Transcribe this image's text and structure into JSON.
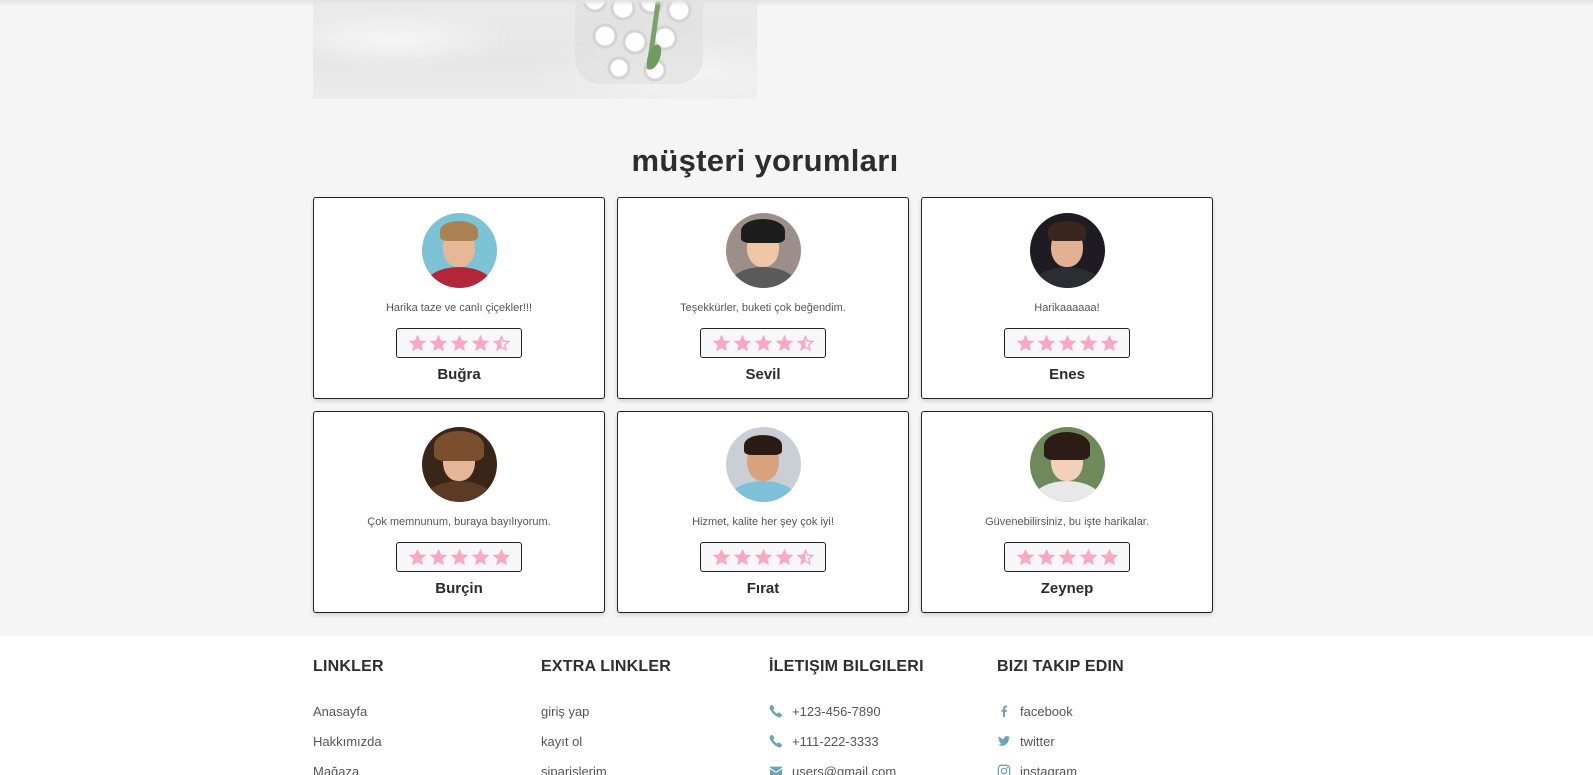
{
  "page": {
    "section_title": "müşteri yorumları"
  },
  "colors": {
    "star": "#f7a8c9",
    "icon": "#6aa7b3",
    "border": "#222222"
  },
  "reviews": [
    {
      "name": "Buğra",
      "text": "Harika taze ve canlı çiçekler!!!",
      "rating": 4.5
    },
    {
      "name": "Sevil",
      "text": "Teşekkürler, buketi çok beğendim.",
      "rating": 4.5
    },
    {
      "name": "Enes",
      "text": "Harikaaaaaa!",
      "rating": 5
    },
    {
      "name": "Burçin",
      "text": "Çok memnunum, buraya bayılıyorum.",
      "rating": 5
    },
    {
      "name": "Fırat",
      "text": "Hizmet, kalite her şey çok iyi!",
      "rating": 4.5
    },
    {
      "name": "Zeynep",
      "text": "Güvenebilirsiniz, bu işte harikalar.",
      "rating": 5
    }
  ],
  "footer": {
    "links": {
      "title": "LINKLER",
      "items": [
        "Anasayfa",
        "Hakkımızda",
        "Mağaza"
      ]
    },
    "extra": {
      "title": "EXTRA LINKLER",
      "items": [
        "giriş yap",
        "kayıt ol",
        "siparişlerim"
      ]
    },
    "contact": {
      "title": "İLETIŞIM BILGILERI",
      "items": [
        {
          "icon": "phone-icon",
          "text": "+123-456-7890"
        },
        {
          "icon": "phone-icon",
          "text": "+111-222-3333"
        },
        {
          "icon": "envelope-icon",
          "text": "users@gmail.com"
        }
      ]
    },
    "social": {
      "title": "BIZI TAKIP EDIN",
      "items": [
        {
          "icon": "facebook-icon",
          "text": "facebook"
        },
        {
          "icon": "twitter-icon",
          "text": "twitter"
        },
        {
          "icon": "instagram-icon",
          "text": "instagram"
        }
      ]
    }
  }
}
